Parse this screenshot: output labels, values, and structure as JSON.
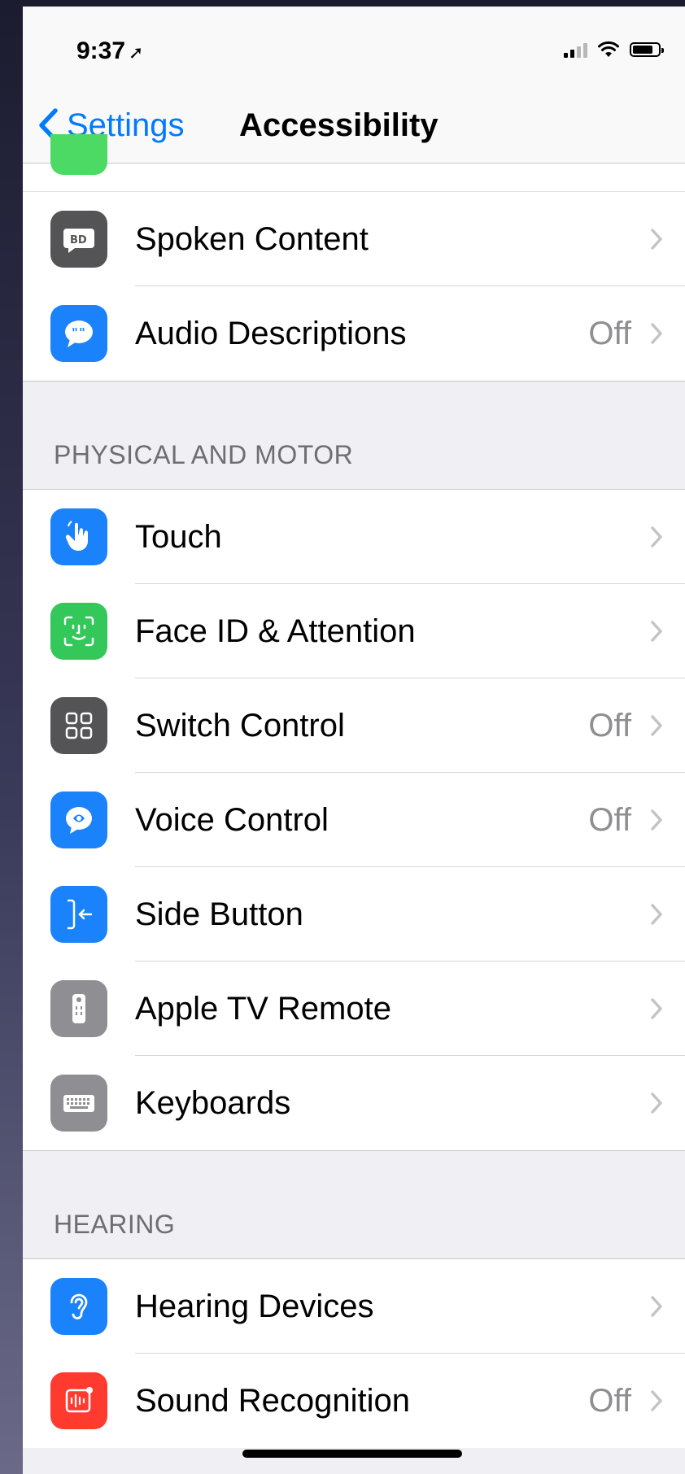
{
  "status_bar": {
    "time": "9:37",
    "location_glyph": "➚"
  },
  "nav": {
    "back_label": "Settings",
    "title": "Accessibility"
  },
  "sections": {
    "vision_tail": {
      "items": [
        {
          "label": "Spoken Content",
          "value": "",
          "icon": "spoken-content-icon",
          "color": "#545456"
        },
        {
          "label": "Audio Descriptions",
          "value": "Off",
          "icon": "audio-descriptions-icon",
          "color": "#1a82fb"
        }
      ]
    },
    "physical": {
      "header": "PHYSICAL AND MOTOR",
      "items": [
        {
          "label": "Touch",
          "value": "",
          "icon": "touch-icon",
          "color": "#1a82fb"
        },
        {
          "label": "Face ID & Attention",
          "value": "",
          "icon": "face-id-icon",
          "color": "#34c759"
        },
        {
          "label": "Switch Control",
          "value": "Off",
          "icon": "switch-control-icon",
          "color": "#545456"
        },
        {
          "label": "Voice Control",
          "value": "Off",
          "icon": "voice-control-icon",
          "color": "#1a82fb"
        },
        {
          "label": "Side Button",
          "value": "",
          "icon": "side-button-icon",
          "color": "#1a82fb"
        },
        {
          "label": "Apple TV Remote",
          "value": "",
          "icon": "apple-tv-remote-icon",
          "color": "#8e8e93"
        },
        {
          "label": "Keyboards",
          "value": "",
          "icon": "keyboards-icon",
          "color": "#8e8e93"
        }
      ]
    },
    "hearing": {
      "header": "HEARING",
      "items": [
        {
          "label": "Hearing Devices",
          "value": "",
          "icon": "hearing-devices-icon",
          "color": "#1a82fb"
        },
        {
          "label": "Sound Recognition",
          "value": "Off",
          "icon": "sound-recognition-icon",
          "color": "#ff3b30"
        }
      ]
    }
  }
}
